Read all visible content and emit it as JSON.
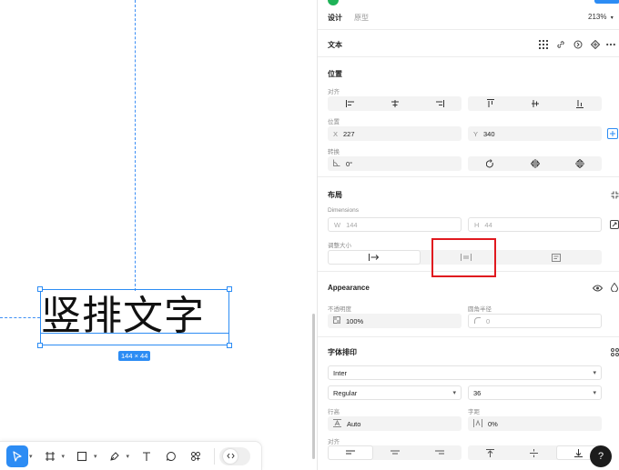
{
  "canvas": {
    "text_content": "竖排文字",
    "size_badge": "144 × 44"
  },
  "toolbar": {
    "tools": [
      {
        "name": "move-tool",
        "icon": "cursor-icon",
        "active": true,
        "caret": true
      },
      {
        "name": "frame-tool",
        "icon": "frame-icon",
        "caret": true
      },
      {
        "name": "shape-tool",
        "icon": "rectangle-icon",
        "caret": true
      },
      {
        "name": "pen-tool",
        "icon": "pen-icon",
        "caret": true
      },
      {
        "name": "text-tool",
        "icon": "text-icon"
      },
      {
        "name": "comment-tool",
        "icon": "comment-icon"
      },
      {
        "name": "plugins-tool",
        "icon": "plugins-icon"
      }
    ],
    "devmode": "code-icon"
  },
  "panel": {
    "tabs": {
      "design": "设计",
      "prototype": "原型"
    },
    "zoom": "213%",
    "text_section": {
      "title": "文本"
    },
    "position": {
      "title": "位置",
      "align_label": "对齐",
      "position_label": "位置",
      "x_prefix": "X",
      "x_value": "227",
      "y_prefix": "Y",
      "y_value": "340",
      "rotation_label": "转换",
      "rotation_value": "0°"
    },
    "layout": {
      "title": "布局",
      "dimensions_label": "Dimensions",
      "w_prefix": "W",
      "w_value": "144",
      "h_prefix": "H",
      "h_value": "44",
      "resize_label": "调整大小"
    },
    "appearance": {
      "title": "Appearance",
      "opacity_label": "不透明度",
      "opacity_value": "100%",
      "radius_label": "圆角半径",
      "radius_value": "0"
    },
    "typography": {
      "title": "字体排印",
      "font_family": "Inter",
      "font_weight": "Regular",
      "font_size": "36",
      "line_height_label": "行高",
      "line_height_value": "Auto",
      "letter_spacing_label": "字距",
      "letter_spacing_value": "0%",
      "align_label": "对齐"
    }
  },
  "help": {
    "label": "?"
  }
}
